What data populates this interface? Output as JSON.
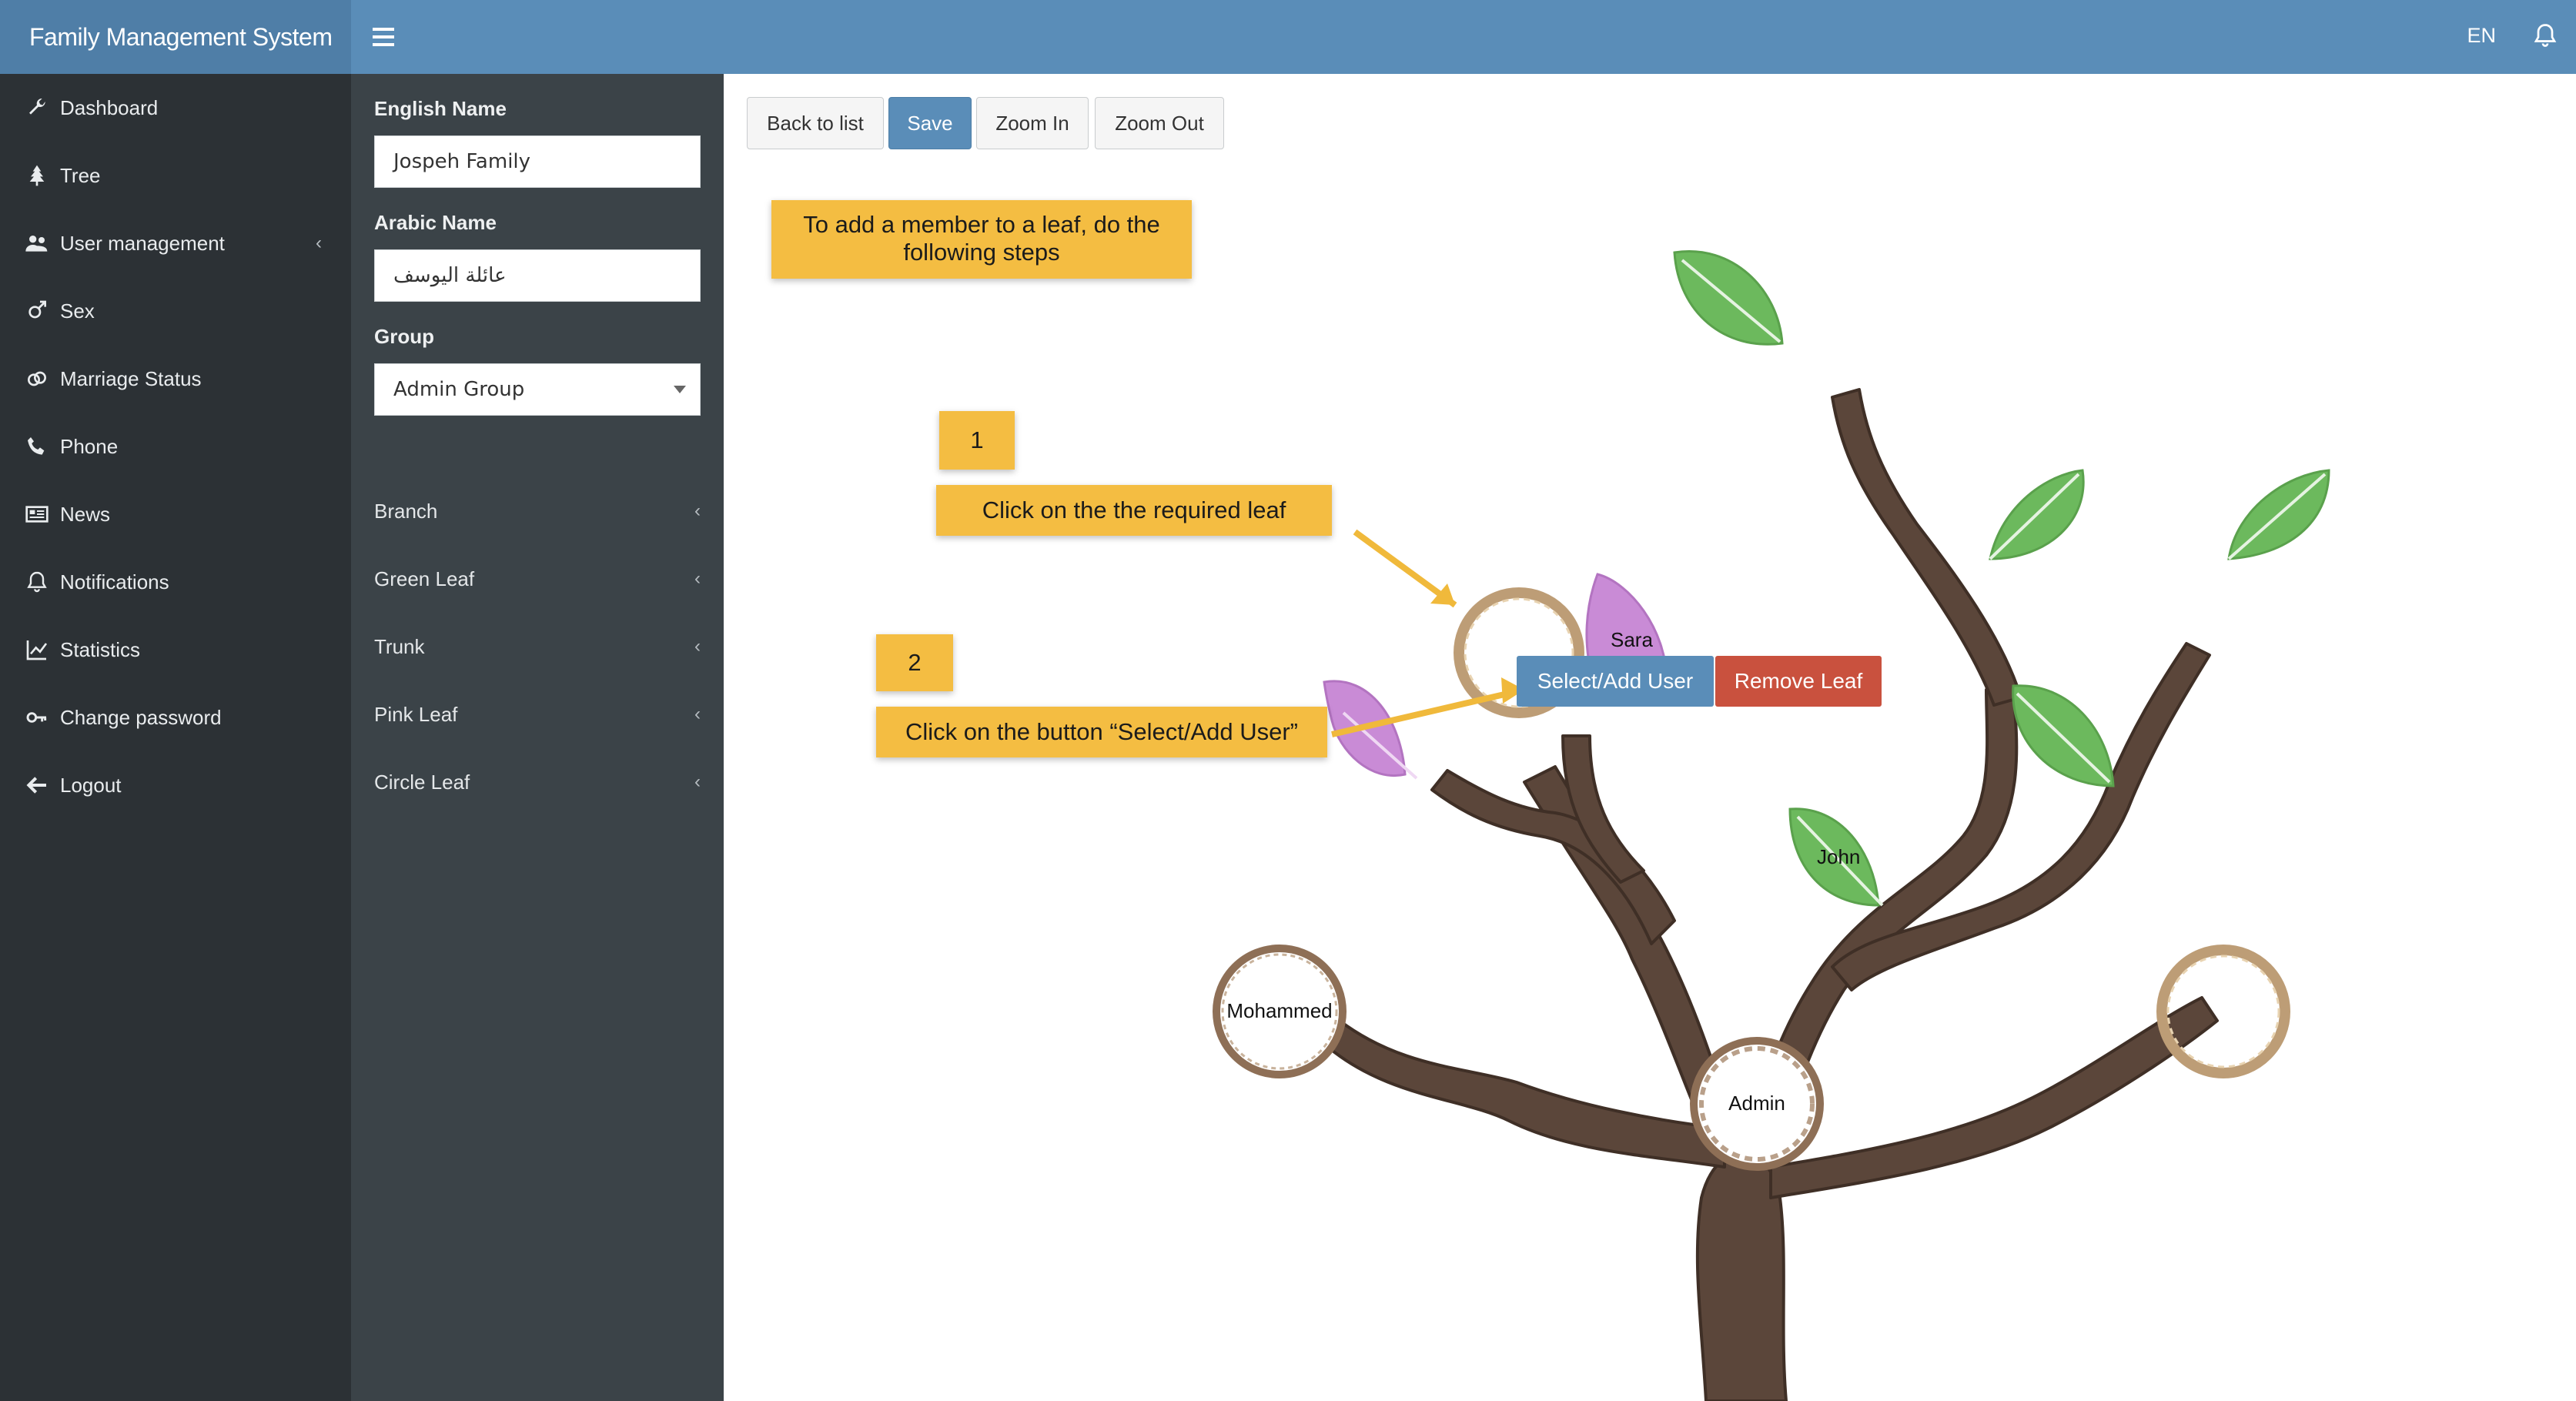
{
  "app": {
    "title": "Family Management System",
    "language": "EN"
  },
  "sidebar": {
    "items": [
      {
        "label": "Dashboard",
        "icon": "wrench-icon"
      },
      {
        "label": "Tree",
        "icon": "tree-icon"
      },
      {
        "label": "User management",
        "icon": "users-icon",
        "has_submenu": true
      },
      {
        "label": "Sex",
        "icon": "gender-icon"
      },
      {
        "label": "Marriage Status",
        "icon": "rings-icon"
      },
      {
        "label": "Phone",
        "icon": "phone-icon"
      },
      {
        "label": "News",
        "icon": "newspaper-icon"
      },
      {
        "label": "Notifications",
        "icon": "bell-icon"
      },
      {
        "label": "Statistics",
        "icon": "chart-icon"
      },
      {
        "label": "Change password",
        "icon": "key-icon"
      },
      {
        "label": "Logout",
        "icon": "arrow-left-icon"
      }
    ]
  },
  "form": {
    "english_name": {
      "label": "English Name",
      "value": "Jospeh Family"
    },
    "arabic_name": {
      "label": "Arabic Name",
      "value": "عائلة اليوسف"
    },
    "group": {
      "label": "Group",
      "value": "Admin Group"
    }
  },
  "panels": [
    "Branch",
    "Green Leaf",
    "Trunk",
    "Pink Leaf",
    "Circle Leaf"
  ],
  "toolbar": {
    "back": "Back to list",
    "save": "Save",
    "zoom_in": "Zoom In",
    "zoom_out": "Zoom Out"
  },
  "guide": {
    "intro": "To add a member to a leaf, do the following steps",
    "step1_number": "1",
    "step1_text": "Click on the the required leaf",
    "step2_number": "2",
    "step2_text": "Click on the button “Select/Add User”"
  },
  "tree": {
    "leaves": {
      "sara": "Sara",
      "john": "John"
    },
    "circles": {
      "mohammed": "Mohammed",
      "admin": "Admin"
    },
    "actions": {
      "select_add": "Select/Add User",
      "remove": "Remove Leaf"
    }
  },
  "colors": {
    "header": "#5a8db8",
    "sidebar": "#2c3135",
    "panel": "#3b4348",
    "callout": "#f4bd42",
    "primary": "#5a8db8",
    "danger": "#c9513e",
    "trunk": "#5b463a",
    "green_leaf": "#6cb95d",
    "pink_leaf": "#c98bd6"
  }
}
